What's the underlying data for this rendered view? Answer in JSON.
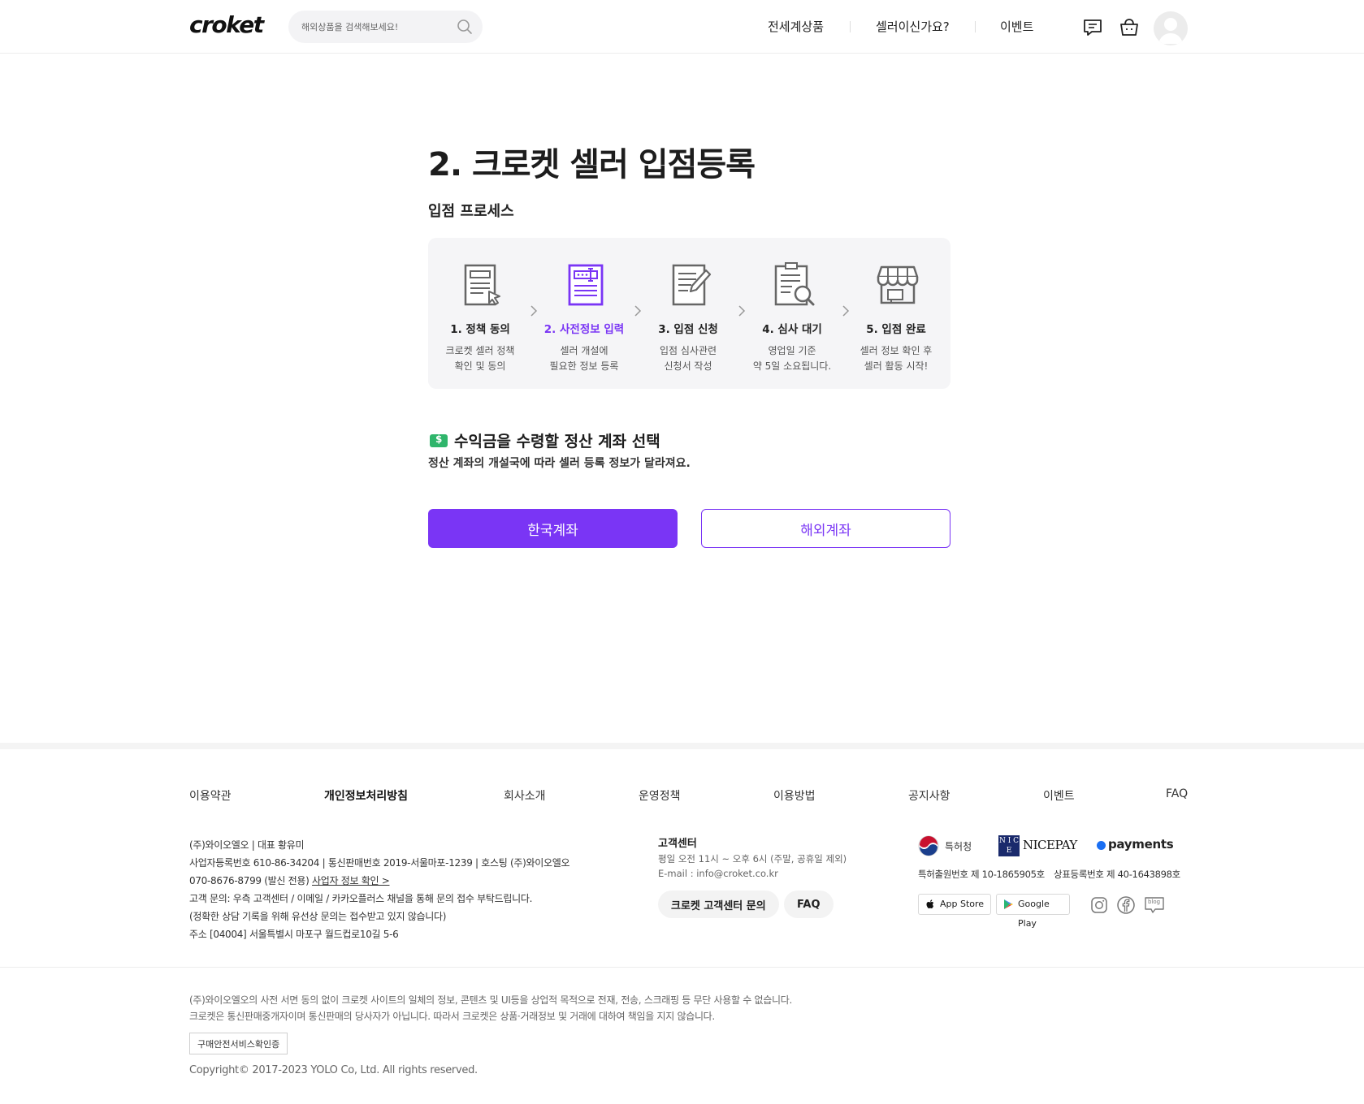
{
  "header": {
    "logo": "croket",
    "search_placeholder": "해외상품을 검색해보세요!",
    "nav": [
      "전세계상품",
      "셀러이신가요?",
      "이벤트"
    ]
  },
  "main": {
    "title": "2. 크로켓 셀러 입점등록",
    "process_title": "입점 프로세스",
    "steps": [
      {
        "name": "1. 정책 동의",
        "desc1": "크로켓 셀러 정책",
        "desc2": "확인 및 동의",
        "icon": "policy-document-icon"
      },
      {
        "name": "2. 사전정보 입력",
        "desc1": "셀러 개설에",
        "desc2": "필요한 정보 등록",
        "icon": "form-input-icon",
        "active": true
      },
      {
        "name": "3. 입점 신청",
        "desc1": "입점 심사관련",
        "desc2": "신청서 작성",
        "icon": "application-pen-icon"
      },
      {
        "name": "4. 심사 대기",
        "desc1": "영업일 기준",
        "desc2": "약 5일 소요됩니다.",
        "icon": "review-magnifier-icon"
      },
      {
        "name": "5. 입점 완료",
        "desc1": "셀러 정보 확인 후",
        "desc2": "셀러 활동 시작!",
        "icon": "storefront-icon"
      }
    ],
    "section_title": "수익금을 수령할 정산 계좌 선택",
    "section_desc": "정산 계좌의 개설국에 따라 셀러 등록 정보가 달라져요.",
    "btn_korea": "한국계좌",
    "btn_overseas": "해외계좌",
    "accent": "#7a35f5"
  },
  "footer": {
    "links": [
      "이용약관",
      "개인정보처리방침",
      "회사소개",
      "운영정책",
      "이용방법",
      "공지사항",
      "이벤트",
      "FAQ"
    ],
    "company": {
      "line1": "(주)와이오엘오 | 대표 황유미",
      "line2": "사업자등록번호 610-86-34204 | 통신판매번호 2019-서울마포-1239 | 호스팅 (주)와이오엘오",
      "line3_prefix": "070-8676-8799 (발신 전용) ",
      "line3_link": "사업자 정보 확인 >",
      "line4": "고객 문의: 우측 고객센터 / 이메일 / 카카오플러스 채널을 통해 문의 접수 부탁드립니다.",
      "line5": "(정확한 상담 기록을 위해 유선상 문의는 접수받고 있지 않습니다)",
      "line6": "주소 [04004] 서울특별시 마포구 월드컵로10길 5-6"
    },
    "cs": {
      "title": "고객센터",
      "hours": "평일 오전 11시 ~ 오후 6시 (주말, 공휴일 제외)",
      "email": "E-mail : info@croket.co.kr",
      "btn_inquiry": "크로켓 고객센터 문의",
      "btn_faq": "FAQ"
    },
    "badges": {
      "kipo": "특허청",
      "nice_mark": "N I C E",
      "nicepay": "NICEPAY",
      "payments": "payments",
      "patent": "특허출원번호 제 10-1865905호",
      "trademark": "상표등록번호 제 40-1643898호"
    },
    "stores": [
      "App Store",
      "Google Play"
    ],
    "blog_label": "blog",
    "legal1": "(주)와이오엘오의 사전 서면 동의 없이 크로켓 사이트의 일체의 정보, 콘텐츠 및 UI등을 상업적 목적으로 전재, 전송, 스크래핑 등 무단 사용할 수 없습니다.",
    "legal2": "크로켓은 통신판매중개자이며 통신판매의 당사자가 아닙니다. 따라서 크로켓은 상품·거래정보 및 거래에 대하여 책임을 지지 않습니다.",
    "cert_btn": "구매안전서비스확인증",
    "copyright": "Copyright© 2017-2023 YOLO Co, Ltd. All rights reserved."
  }
}
